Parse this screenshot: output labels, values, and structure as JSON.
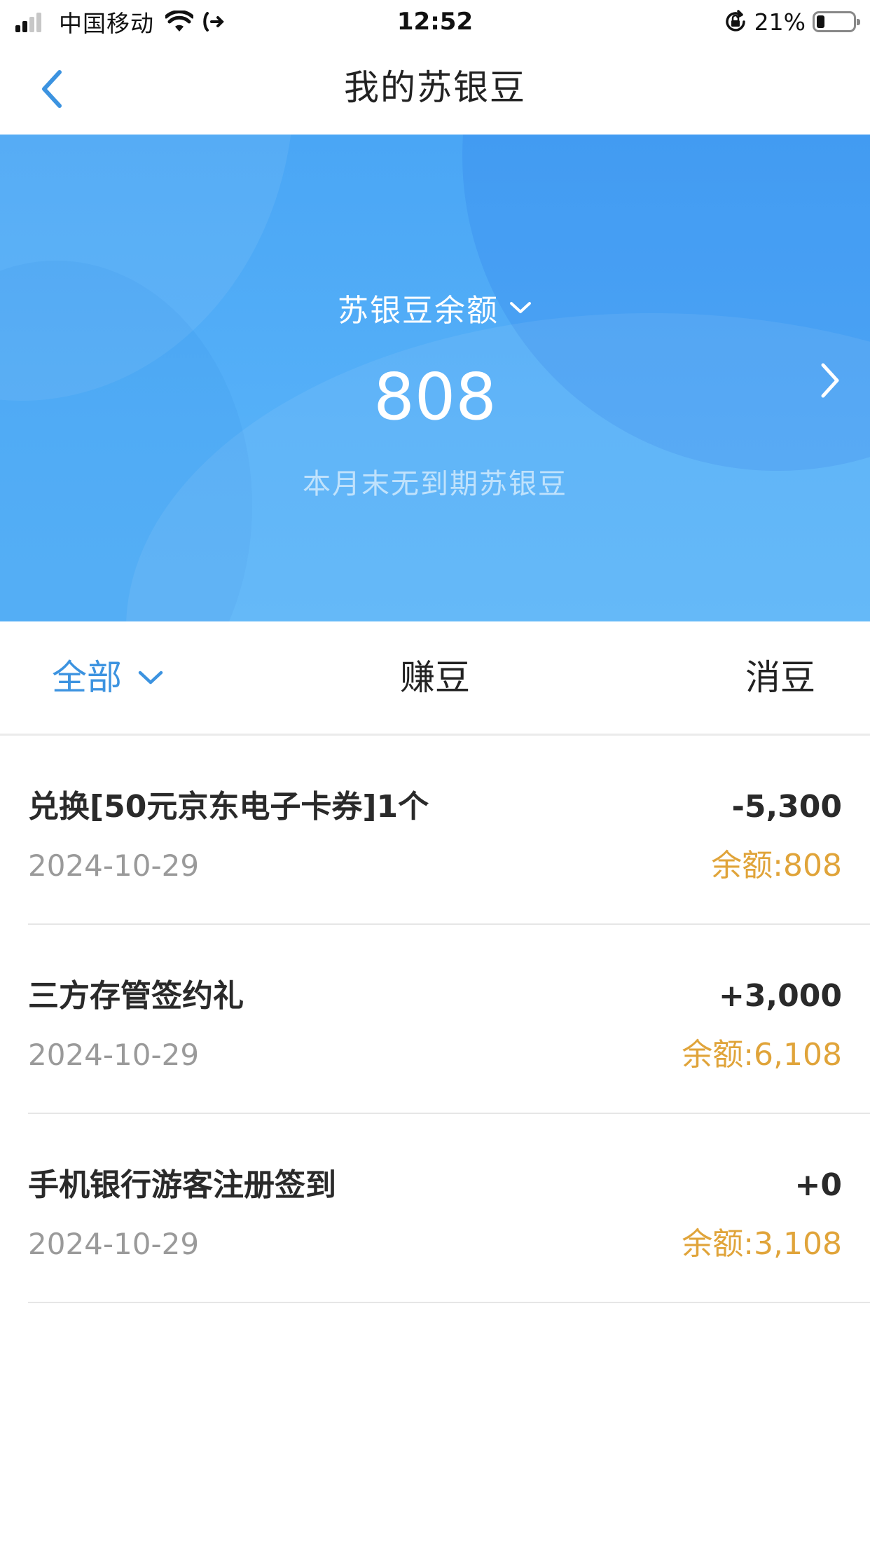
{
  "status_bar": {
    "carrier": "中国移动",
    "time": "12:52",
    "battery_percent": "21%",
    "battery_level": 0.21,
    "signal_bars": 2
  },
  "nav": {
    "title": "我的苏银豆",
    "back_icon": "chevron-left-icon"
  },
  "balance": {
    "label": "苏银豆余额",
    "value": "808",
    "subtitle": "本月末无到期苏银豆"
  },
  "tabs": [
    {
      "label": "全部",
      "active": true
    },
    {
      "label": "赚豆",
      "active": false
    },
    {
      "label": "消豆",
      "active": false
    }
  ],
  "transactions": [
    {
      "title": "兑换[50元京东电子卡券]1个",
      "date": "2024-10-29",
      "amount": "-5,300",
      "balance": "余额:808"
    },
    {
      "title": "三方存管签约礼",
      "date": "2024-10-29",
      "amount": "+3,000",
      "balance": "余额:6,108"
    },
    {
      "title": "手机银行游客注册签到",
      "date": "2024-10-29",
      "amount": "+0",
      "balance": "余额:3,108"
    }
  ],
  "colors": {
    "accent_blue": "#3c93e0",
    "banner_blue": "#55b0f8",
    "balance_orange": "#e0a43a"
  }
}
